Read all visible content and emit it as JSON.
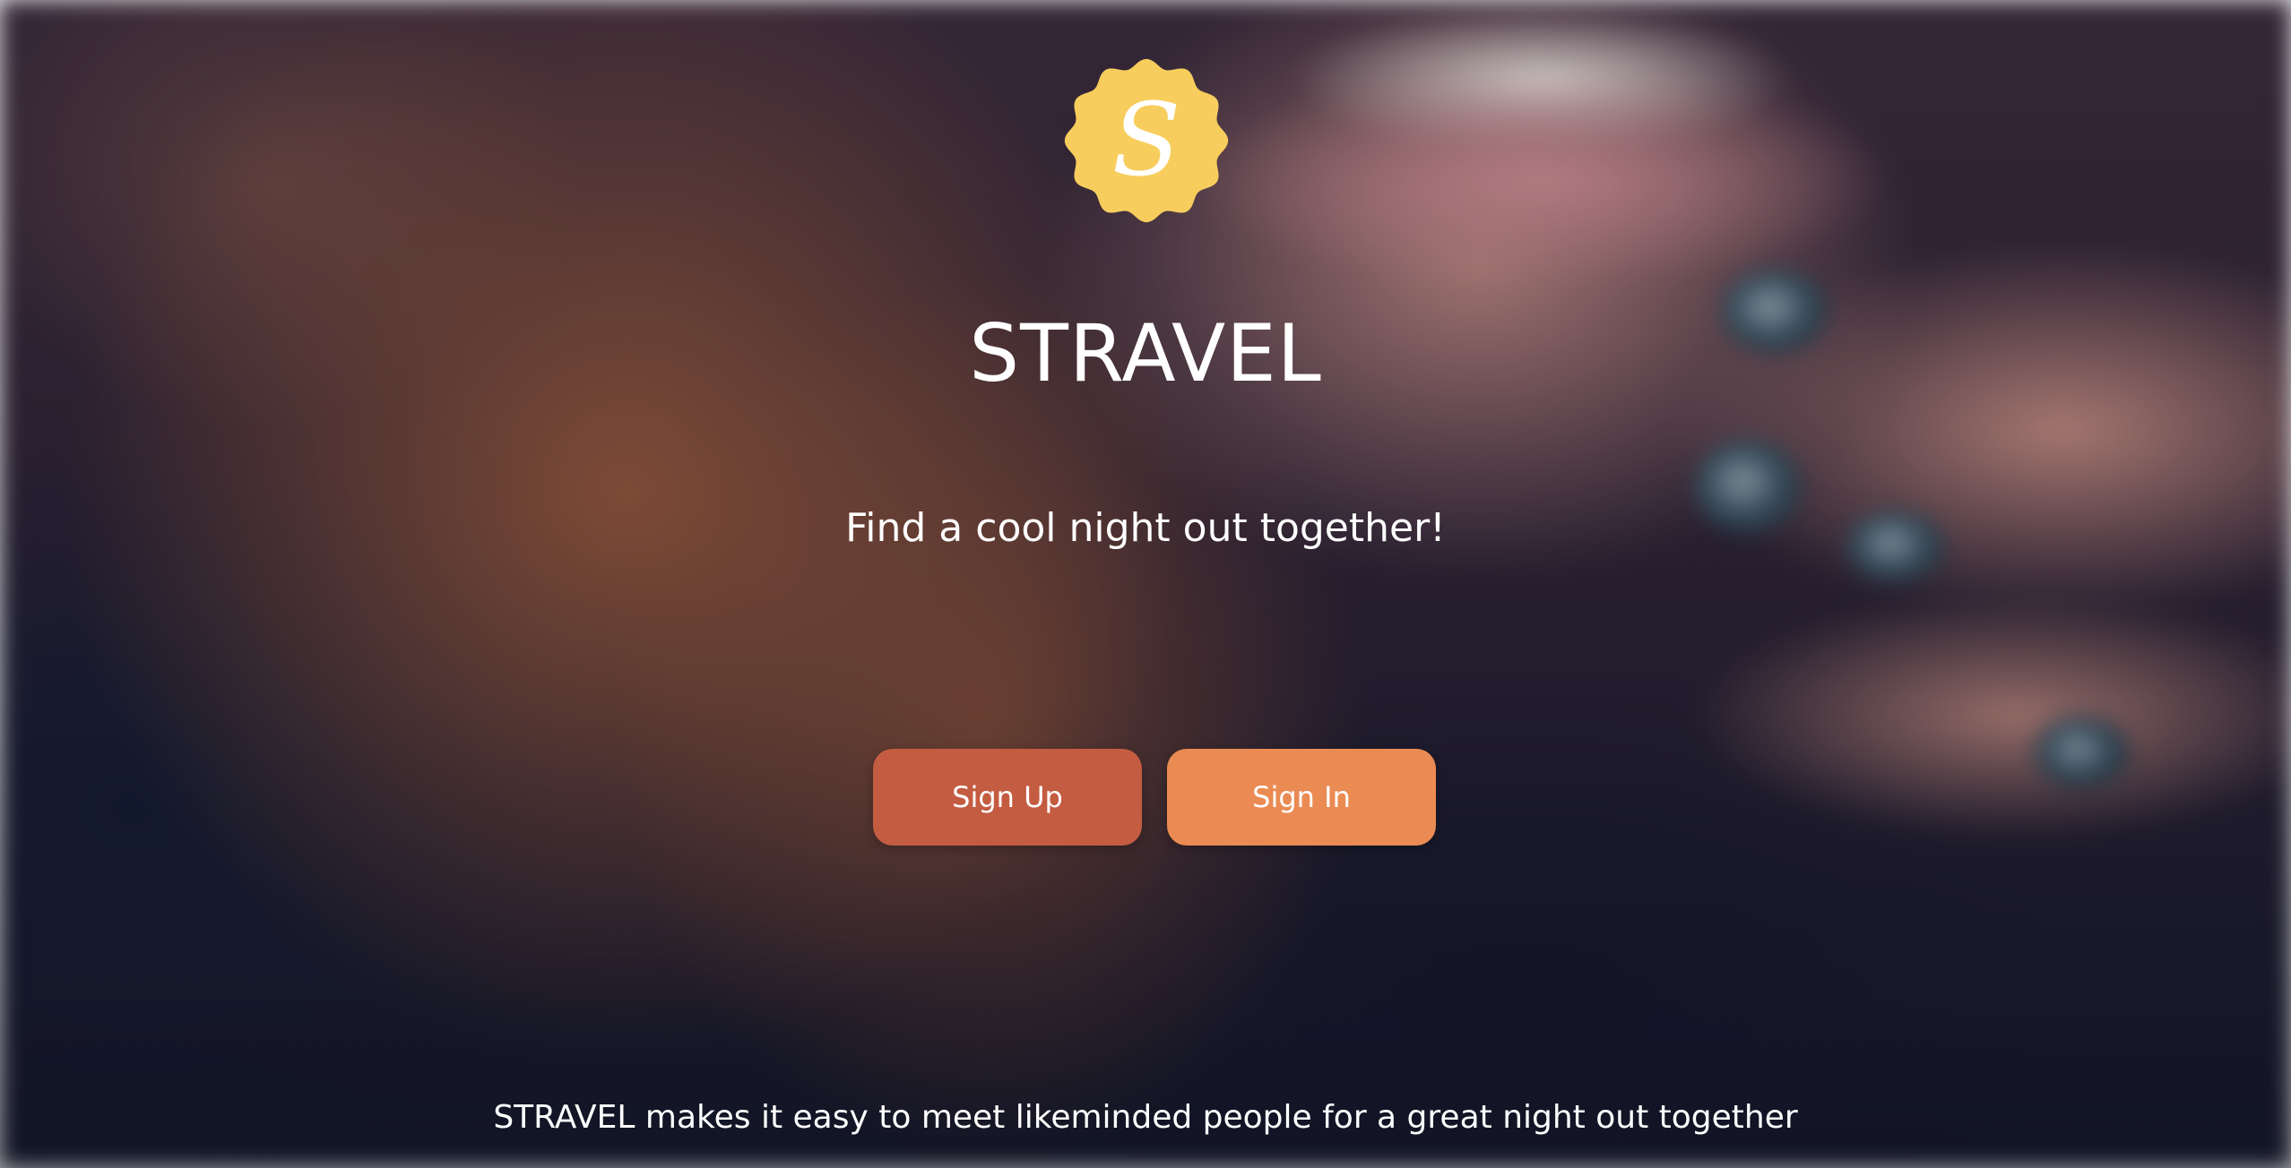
{
  "brand": {
    "logo_letter": "S",
    "title": "STRAVEL"
  },
  "hero": {
    "tagline": "Find a cool night out together!"
  },
  "actions": {
    "signup_label": "Sign Up",
    "signin_label": "Sign In"
  },
  "footer": {
    "text": "STRAVEL makes it easy to meet likeminded people for a great night out together"
  },
  "colors": {
    "logo_badge": "#f7cd5d",
    "signup_button": "#c45c41",
    "signin_button": "#ea8b53",
    "text": "#ffffff"
  },
  "icons": {
    "logo": "scalloped-badge-letter-s-icon"
  }
}
